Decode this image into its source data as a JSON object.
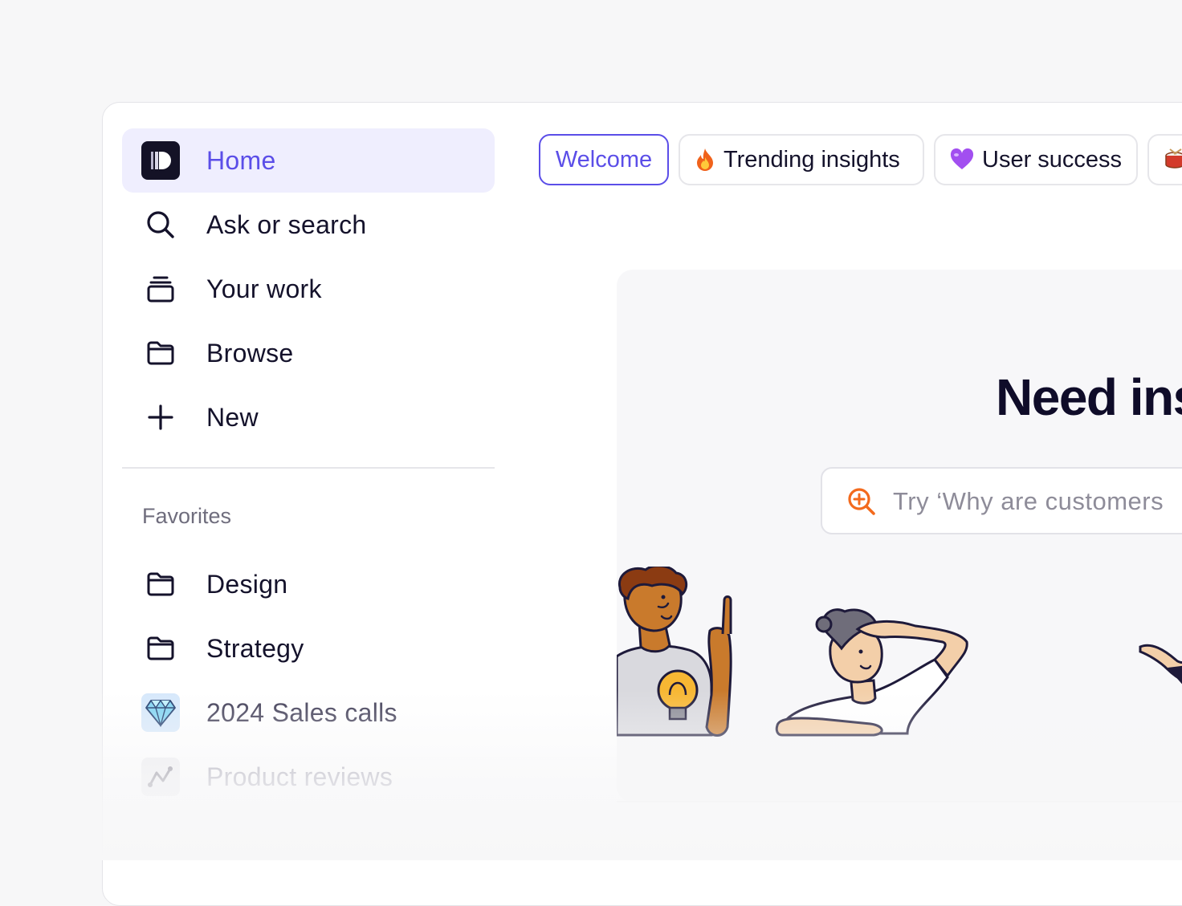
{
  "sidebar": {
    "items": [
      {
        "label": "Home",
        "icon": "logo-icon",
        "active": true
      },
      {
        "label": "Ask or search",
        "icon": "search-icon"
      },
      {
        "label": "Your work",
        "icon": "stack-icon"
      },
      {
        "label": "Browse",
        "icon": "folder-icon"
      },
      {
        "label": "New",
        "icon": "plus-icon"
      }
    ],
    "favorites_label": "Favorites",
    "favorites": [
      {
        "label": "Design",
        "icon": "folder-icon"
      },
      {
        "label": "Strategy",
        "icon": "folder-icon"
      },
      {
        "label": "2024 Sales calls",
        "icon": "diamond-icon"
      },
      {
        "label": "Product reviews",
        "icon": "trend-icon"
      }
    ]
  },
  "tabs": [
    {
      "label": "Welcome",
      "active": true
    },
    {
      "label": "Trending insights",
      "emoji": "fire-emoji"
    },
    {
      "label": "User success",
      "emoji": "purple-heart-emoji"
    },
    {
      "label": "",
      "emoji": "drum-emoji"
    }
  ],
  "main": {
    "headline": "Need ins",
    "search_placeholder": "Try ‘Why are customers"
  },
  "colors": {
    "accent": "#5b4ee8",
    "active_bg": "#efeefe",
    "search_icon": "#f36a1d"
  }
}
